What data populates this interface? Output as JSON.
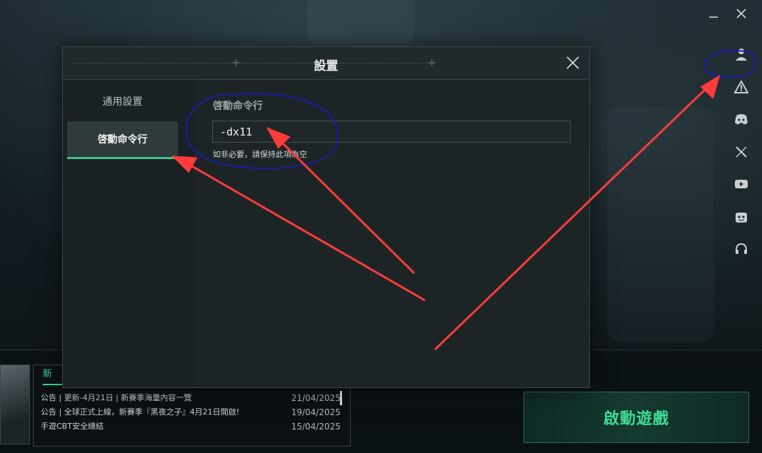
{
  "window": {
    "minimize_icon": "minus-icon",
    "close_icon": "close-icon"
  },
  "rail": {
    "items": [
      {
        "name": "account",
        "icon": "user-icon"
      },
      {
        "name": "alert",
        "icon": "warning-icon"
      },
      {
        "name": "discord",
        "icon": "discord-icon"
      },
      {
        "name": "x",
        "icon": "x-logo-icon"
      },
      {
        "name": "youtube",
        "icon": "youtube-icon"
      },
      {
        "name": "reddit",
        "icon": "reddit-icon"
      },
      {
        "name": "support",
        "icon": "headset-icon"
      }
    ]
  },
  "dialog": {
    "title": "設置",
    "sidebar": {
      "items": [
        {
          "label": "通用設置",
          "active": false
        },
        {
          "label": "啓動命令行",
          "active": true
        }
      ]
    },
    "section_title": "啓動命令行",
    "command_value": "-dx11",
    "hint": "如非必要，請保持此項為空"
  },
  "news": {
    "tab_label": "新",
    "items": [
      {
        "title": "公告 | 更新-4月21日 | 新賽季海量內容一覽",
        "date": "21/04/2025"
      },
      {
        "title": "公告 | 全球正式上線，新賽季『黑夜之子』4月21日開啟!",
        "date": "19/04/2025"
      },
      {
        "title": "手遊CBT安全總結",
        "date": "15/04/2025"
      }
    ]
  },
  "launch_button": {
    "label": "啟動遊戲"
  },
  "colors": {
    "accent": "#3ddc97",
    "annotation_arrow": "#ff3b3b",
    "annotation_circle": "#1a1aa8"
  }
}
